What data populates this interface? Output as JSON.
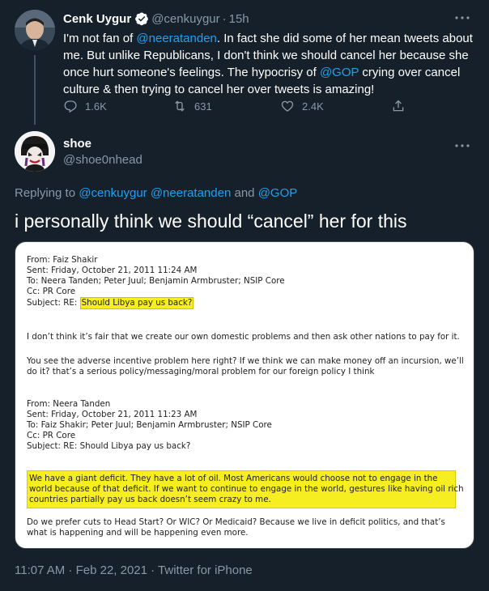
{
  "parent_tweet": {
    "author_name": "Cenk Uygur",
    "handle": "@cenkuygur",
    "separator": "·",
    "time": "15h",
    "text_1": "I'm not fan of ",
    "mention_1": "@neeratanden",
    "text_2": ". In fact she did some of her mean tweets about me. But unlike Republicans, I don't think we should cancel her because she once hurt someone's feelings. The hypocrisy of ",
    "mention_2": "@GOP",
    "text_3": " crying over cancel culture & then trying to cancel her over tweets is amazing!",
    "replies": "1.6K",
    "retweets": "631",
    "likes": "2.4K"
  },
  "reply_tweet": {
    "author_name": "shoe",
    "handle": "@shoe0nhead",
    "replying_prefix": "Replying to ",
    "replying_mention_1": "@cenkuygur",
    "replying_mention_2": "@neeratanden",
    "replying_and": " and ",
    "replying_mention_3": "@GOP",
    "text": "i personally think we should “cancel” her for this",
    "timestamp": "11:07 AM · Feb 22, 2021 · Twitter for iPhone"
  },
  "document": {
    "email1": {
      "from": "From: Faiz Shakir",
      "sent": "Sent: Friday, October 21, 2011 11:24 AM",
      "to": "To: Neera Tanden; Peter Juul; Benjamin Armbruster; NSIP Core",
      "cc": "Cc: PR Core",
      "subject_prefix": "Subject: RE: ",
      "subject_highlight": "Should Libya pay us back?",
      "para1": "I don’t think it’s fair that we create our own domestic problems and then ask other nations to pay for it.",
      "para2_line1": "You see the adverse incentive problem here right? If we think we can make money off an incursion, we’ll",
      "para2_line2": "do it? that’s a serious policy/messaging/moral problem for our foreign policy I think"
    },
    "email2": {
      "from": "From: Neera Tanden",
      "sent": "Sent: Friday, October 21, 2011 11:23 AM",
      "to": "To: Faiz Shakir; Peter Juul; Benjamin Armbruster; NSIP Core",
      "cc": "Cc: PR Core",
      "subject": "Subject: RE: Should Libya pay us back?",
      "hl_line1": "We have a giant deficit.  They have a lot of oil.  Most Americans would choose not to engage in the",
      "hl_line2": "world because of that deficit.  If we want to continue to engage in the world, gestures like having oil rich",
      "hl_line3": "countries partially pay us back doesn’t seem crazy to me.",
      "para_line1": "Do we prefer cuts to Head Start? Or WIC?  Or Medicaid?  Because we live in deficit politics, and that’s",
      "para_line2": "what is happening and will be happening even more."
    }
  },
  "colors": {
    "background": "#15202b",
    "accent": "#1da1f2",
    "muted": "#8899a6",
    "highlight": "#f6ee21"
  },
  "icons": [
    "verified-badge-icon",
    "more-options-icon",
    "reply-icon",
    "retweet-icon",
    "like-icon",
    "share-icon"
  ]
}
